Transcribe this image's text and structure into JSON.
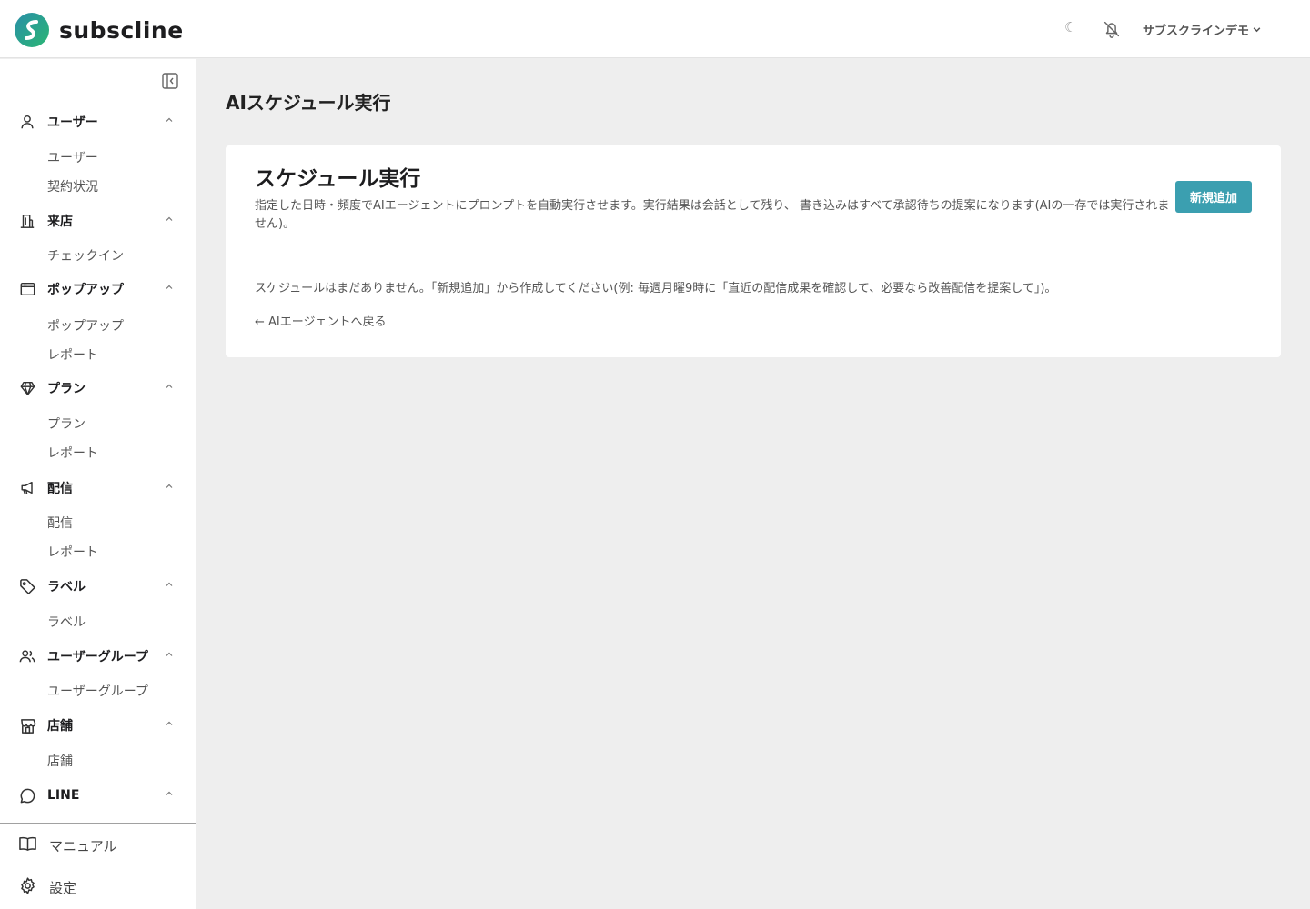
{
  "brand": {
    "name": "subscline"
  },
  "header": {
    "theme_icon": "☾",
    "account_label": "サブスクラインデモ"
  },
  "sidebar": {
    "groups": [
      {
        "icon": "user-icon",
        "label": "ユーザー",
        "items": [
          "ユーザー",
          "契約状況"
        ]
      },
      {
        "icon": "building-icon",
        "label": "来店",
        "items": [
          "チェックイン"
        ]
      },
      {
        "icon": "window-icon",
        "label": "ポップアップ",
        "items": [
          "ポップアップ",
          "レポート"
        ]
      },
      {
        "icon": "gem-icon",
        "label": "プラン",
        "items": [
          "プラン",
          "レポート"
        ]
      },
      {
        "icon": "megaphone-icon",
        "label": "配信",
        "items": [
          "配信",
          "レポート"
        ]
      },
      {
        "icon": "tag-icon",
        "label": "ラベル",
        "items": [
          "ラベル"
        ]
      },
      {
        "icon": "users-icon",
        "label": "ユーザーグループ",
        "items": [
          "ユーザーグループ"
        ]
      },
      {
        "icon": "store-icon",
        "label": "店舗",
        "items": [
          "店舗"
        ]
      },
      {
        "icon": "chat-icon",
        "label": "LINE",
        "items": []
      }
    ],
    "footer": [
      {
        "icon": "book-icon",
        "label": "マニュアル"
      },
      {
        "icon": "gear-icon",
        "label": "設定"
      }
    ]
  },
  "main": {
    "page_title": "AIスケジュール実行",
    "card": {
      "title": "スケジュール実行",
      "description": "指定した日時・頻度でAIエージェントにプロンプトを自動実行させます。実行結果は会話として残り、 書き込みはすべて承認待ちの提案になります(AIの一存では実行されません)。",
      "new_button": "新規追加",
      "empty_message": "スケジュールはまだありません。「新規追加」から作成してください(例: 毎週月曜9時に「直近の配信成果を確認して、必要なら改善配信を提案して」)。",
      "back_link": "← AIエージェントへ戻る"
    }
  },
  "colors": {
    "accent": "#3b9fb0",
    "logo_green": "#2bb673",
    "logo_teal": "#2a8fa8"
  }
}
